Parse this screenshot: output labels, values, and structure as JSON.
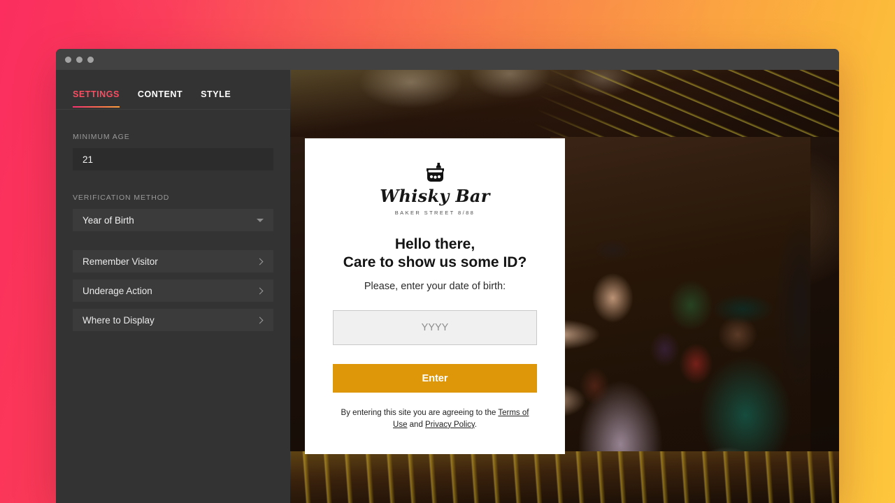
{
  "window": {
    "traffic_lights": [
      "close",
      "minimize",
      "zoom"
    ]
  },
  "sidebar": {
    "tabs": [
      {
        "label": "SETTINGS",
        "active": true
      },
      {
        "label": "CONTENT",
        "active": false
      },
      {
        "label": "STYLE",
        "active": false
      }
    ],
    "minimum_age": {
      "label": "MINIMUM AGE",
      "value": "21"
    },
    "verification_method": {
      "label": "VERIFICATION METHOD",
      "value": "Year of Birth"
    },
    "rows": [
      {
        "label": "Remember Visitor"
      },
      {
        "label": "Underage Action"
      },
      {
        "label": "Where to Display"
      }
    ]
  },
  "modal": {
    "logo": {
      "icon": "whisky-glass-icon",
      "name": "Whisky Bar",
      "subtitle": "BAKER STREET 8/88"
    },
    "headline_line1": "Hello there,",
    "headline_line2": "Care to show us some ID?",
    "subhead": "Please, enter your date of birth:",
    "input": {
      "placeholder": "YYYY",
      "value": ""
    },
    "enter_label": "Enter",
    "legal": {
      "prefix": "By entering this site you are agreeing to the ",
      "terms_link": "Terms of Use",
      "middle": " and ",
      "privacy_link": "Privacy Policy",
      "suffix": "."
    }
  },
  "colors": {
    "accent_pink": "#f94d62",
    "accent_orange": "#f9a03c",
    "button_gold": "#dd9709",
    "sidebar_bg": "#333333",
    "titlebar_bg": "#424242"
  }
}
